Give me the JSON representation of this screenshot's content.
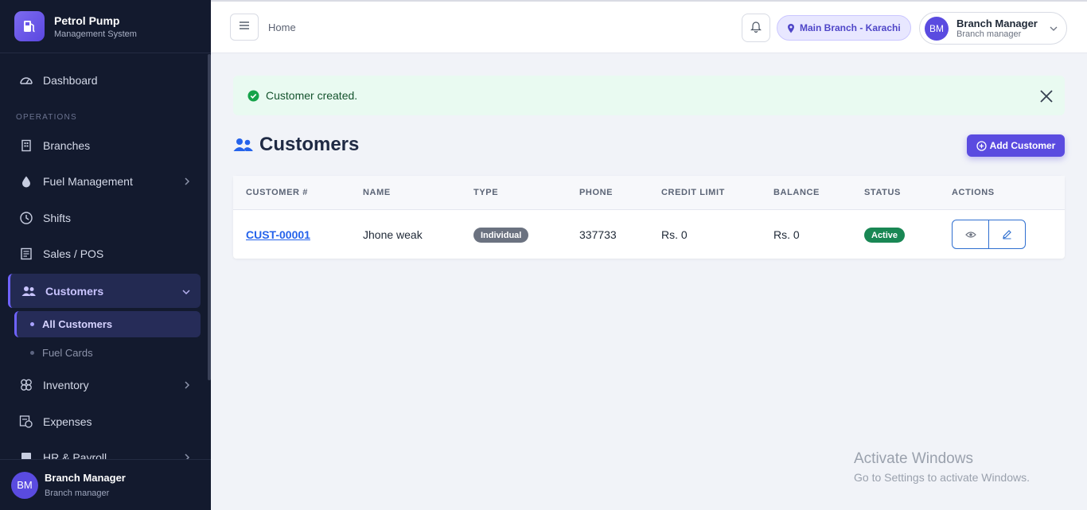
{
  "brand": {
    "title": "Petrol Pump",
    "subtitle": "Management System",
    "icon": "fuel-pump-icon"
  },
  "sidebar": {
    "section_label": "OPERATIONS",
    "items": [
      {
        "label": "Dashboard",
        "icon": "dashboard-gauge-icon"
      },
      {
        "label": "Branches",
        "icon": "building-icon"
      },
      {
        "label": "Fuel Management",
        "icon": "droplet-icon"
      },
      {
        "label": "Shifts",
        "icon": "clock-icon"
      },
      {
        "label": "Sales / POS",
        "icon": "receipt-icon"
      },
      {
        "label": "Customers",
        "icon": "users-icon"
      },
      {
        "label": "Inventory",
        "icon": "boxes-icon"
      },
      {
        "label": "Expenses",
        "icon": "expense-icon"
      },
      {
        "label": "HR & Payroll",
        "icon": "id-card-icon"
      }
    ],
    "sub_items": [
      {
        "label": "All Customers"
      },
      {
        "label": "Fuel Cards"
      }
    ],
    "user": {
      "initials": "BM",
      "name": "Branch Manager",
      "role": "Branch manager"
    }
  },
  "header": {
    "breadcrumb": "Home",
    "branch": "Main Branch - Karachi",
    "user": {
      "initials": "BM",
      "name": "Branch Manager",
      "role": "Branch manager"
    }
  },
  "alert": {
    "message": "Customer created."
  },
  "page": {
    "title": "Customers",
    "add_button": "Add Customer"
  },
  "table": {
    "headers": [
      "CUSTOMER #",
      "NAME",
      "TYPE",
      "PHONE",
      "CREDIT LIMIT",
      "BALANCE",
      "STATUS",
      "ACTIONS"
    ],
    "rows": [
      {
        "id": "CUST-00001",
        "name": "Jhone weak",
        "type": "Individual",
        "phone": "337733",
        "credit_limit": "Rs. 0",
        "balance": "Rs. 0",
        "status": "Active"
      }
    ]
  },
  "watermark": {
    "line1": "Activate Windows",
    "line2": "Go to Settings to activate Windows."
  },
  "colors": {
    "sidebar_bg": "#131a2e",
    "accent": "#5a4be0",
    "success": "#198754",
    "link": "#2563eb"
  }
}
